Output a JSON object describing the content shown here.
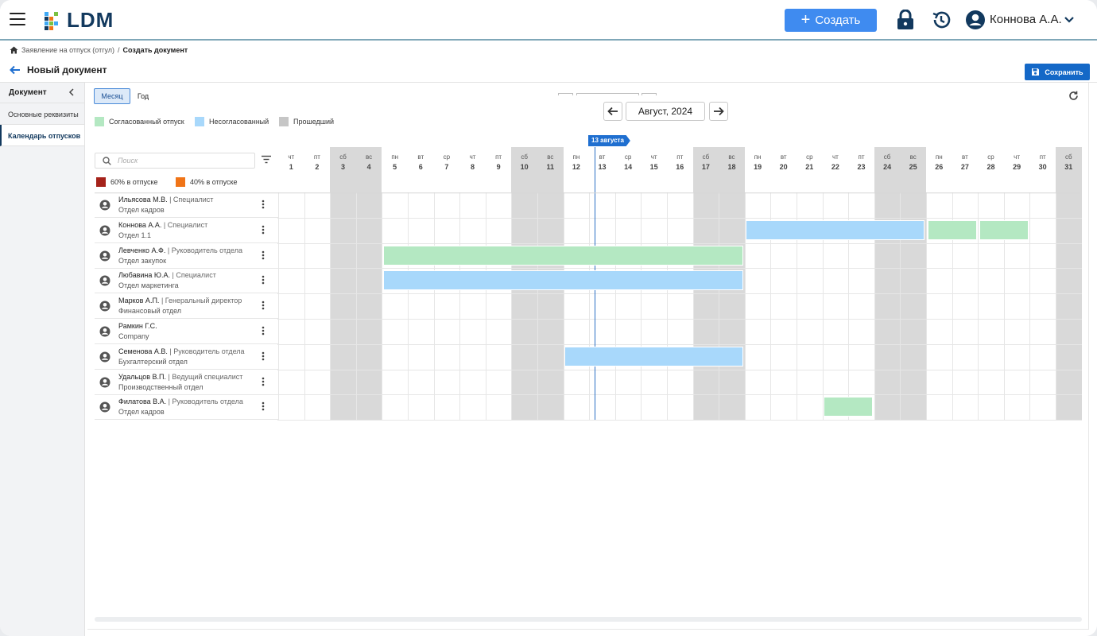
{
  "app": {
    "logo_text": "LDM",
    "create_label": "Создать",
    "user_name": "Коннова А.А."
  },
  "breadcrumb": {
    "parent": "Заявление на отпуск (отгул)",
    "separator": "/",
    "current": "Создать документ"
  },
  "page": {
    "title": "Новый документ",
    "save_label": "Сохранить"
  },
  "sidebar": {
    "header": "Документ",
    "items": [
      {
        "label": "Основные реквизиты",
        "active": false
      },
      {
        "label": "Календарь отпусков",
        "active": true
      }
    ]
  },
  "calendar": {
    "view_month": "Месяц",
    "view_year": "Год",
    "current_view": "month",
    "period_label": "Август, 2024",
    "today_label": "13 августа",
    "today_day": 13,
    "search_placeholder": "Поиск",
    "legend": [
      {
        "label": "Согласованный отпуск",
        "color": "#b4e8c2"
      },
      {
        "label": "Несогласованный",
        "color": "#a8d8fb"
      },
      {
        "label": "Прошедший",
        "color": "#c6c6c6"
      }
    ],
    "load_legend": [
      {
        "label": "60% в отпуске",
        "color": "#a5221a"
      },
      {
        "label": "40% в отпуске",
        "color": "#f07417"
      }
    ],
    "days": [
      {
        "dow": "чт",
        "day": 1,
        "weekend": false
      },
      {
        "dow": "пт",
        "day": 2,
        "weekend": false
      },
      {
        "dow": "сб",
        "day": 3,
        "weekend": true
      },
      {
        "dow": "вс",
        "day": 4,
        "weekend": true
      },
      {
        "dow": "пн",
        "day": 5,
        "weekend": false
      },
      {
        "dow": "вт",
        "day": 6,
        "weekend": false
      },
      {
        "dow": "ср",
        "day": 7,
        "weekend": false
      },
      {
        "dow": "чт",
        "day": 8,
        "weekend": false
      },
      {
        "dow": "пт",
        "day": 9,
        "weekend": false
      },
      {
        "dow": "сб",
        "day": 10,
        "weekend": true
      },
      {
        "dow": "вс",
        "day": 11,
        "weekend": true
      },
      {
        "dow": "пн",
        "day": 12,
        "weekend": false
      },
      {
        "dow": "вт",
        "day": 13,
        "weekend": false
      },
      {
        "dow": "ср",
        "day": 14,
        "weekend": false
      },
      {
        "dow": "чт",
        "day": 15,
        "weekend": false
      },
      {
        "dow": "пт",
        "day": 16,
        "weekend": false
      },
      {
        "dow": "сб",
        "day": 17,
        "weekend": true
      },
      {
        "dow": "вс",
        "day": 18,
        "weekend": true
      },
      {
        "dow": "пн",
        "day": 19,
        "weekend": false
      },
      {
        "dow": "вт",
        "day": 20,
        "weekend": false
      },
      {
        "dow": "ср",
        "day": 21,
        "weekend": false
      },
      {
        "dow": "чт",
        "day": 22,
        "weekend": false
      },
      {
        "dow": "пт",
        "day": 23,
        "weekend": false
      },
      {
        "dow": "сб",
        "day": 24,
        "weekend": true
      },
      {
        "dow": "вс",
        "day": 25,
        "weekend": true
      },
      {
        "dow": "пн",
        "day": 26,
        "weekend": false
      },
      {
        "dow": "вт",
        "day": 27,
        "weekend": false
      },
      {
        "dow": "ср",
        "day": 28,
        "weekend": false
      },
      {
        "dow": "чт",
        "day": 29,
        "weekend": false
      },
      {
        "dow": "пт",
        "day": 30,
        "weekend": false
      },
      {
        "dow": "сб",
        "day": 31,
        "weekend": true
      }
    ],
    "employees": [
      {
        "name": "Ильясова М.В.",
        "role": "| Специалист",
        "dept": "Отдел кадров",
        "vacations": []
      },
      {
        "name": "Коннова А.А.",
        "role": "| Специалист",
        "dept": "Отдел 1.1",
        "vacations": [
          {
            "from": 19,
            "to": 25,
            "status": "unapproved"
          },
          {
            "from": 26,
            "to": 27,
            "status": "approved"
          },
          {
            "from": 28,
            "to": 29,
            "status": "approved"
          }
        ]
      },
      {
        "name": "Левченко А.Ф.",
        "role": "| Руководитель отдела",
        "dept": "Отдел закупок",
        "vacations": [
          {
            "from": 5,
            "to": 18,
            "status": "approved"
          }
        ]
      },
      {
        "name": "Любавина Ю.А.",
        "role": "| Специалист",
        "dept": "Отдел маркетинга",
        "vacations": [
          {
            "from": 5,
            "to": 18,
            "status": "unapproved"
          }
        ]
      },
      {
        "name": "Марков А.П.",
        "role": "| Генеральный директор",
        "dept": "Финансовый отдел",
        "vacations": []
      },
      {
        "name": "Рамкин Г.С.",
        "role": "",
        "dept": "Company",
        "vacations": []
      },
      {
        "name": "Семенова А.В.",
        "role": "| Руководитель отдела",
        "dept": "Бухгалтерский отдел",
        "vacations": [
          {
            "from": 12,
            "to": 18,
            "status": "unapproved"
          }
        ]
      },
      {
        "name": "Удальцов В.П.",
        "role": "| Ведущий специалист",
        "dept": "Производственный отдел",
        "vacations": []
      },
      {
        "name": "Филатова В.А.",
        "role": "| Руководитель отдела",
        "dept": "Отдел кадров",
        "vacations": [
          {
            "from": 22,
            "to": 23,
            "status": "approved"
          }
        ]
      }
    ]
  },
  "colors": {
    "approved": "#b4e8c2",
    "unapproved": "#a8d8fb",
    "weekend": "#d9d9d9",
    "accent": "#1f6fd0",
    "primary_button": "#3f8bf0",
    "save_button": "#1468c7",
    "brand_dark": "#12395e"
  }
}
